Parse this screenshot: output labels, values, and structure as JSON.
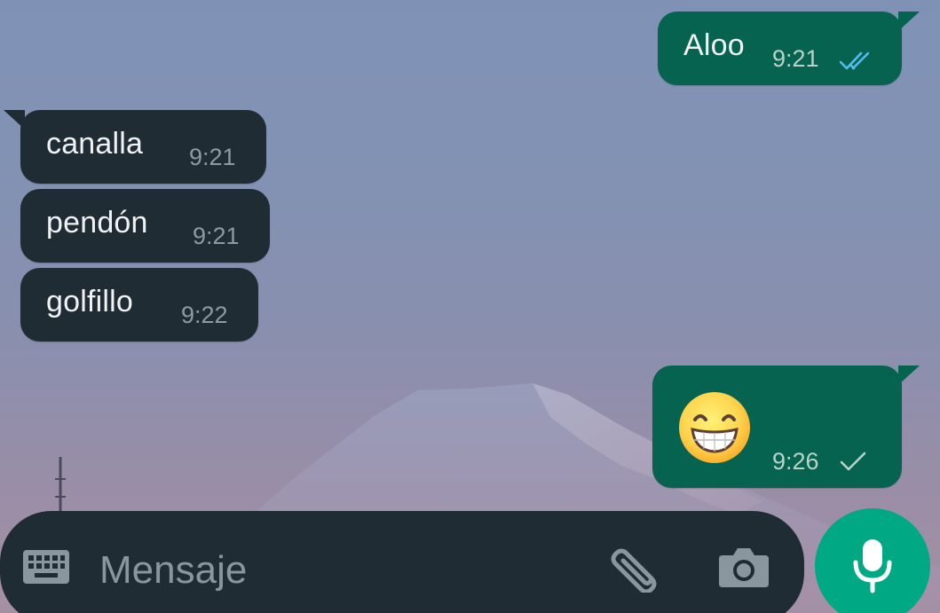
{
  "chat": {
    "messages": [
      {
        "direction": "outgoing",
        "text": "Aloo",
        "time": "9:21",
        "status": "read"
      },
      {
        "direction": "incoming",
        "text": "canalla",
        "time": "9:21"
      },
      {
        "direction": "incoming",
        "text": "pendón",
        "time": "9:21"
      },
      {
        "direction": "incoming",
        "text": "golfillo",
        "time": "9:22"
      },
      {
        "direction": "outgoing",
        "text": "",
        "emoji": "grinning-face-with-smiling-eyes",
        "time": "9:26",
        "status": "sent"
      }
    ]
  },
  "composer": {
    "placeholder": "Mensaje",
    "icons": {
      "keyboard": "keyboard-icon",
      "attach": "paperclip-icon",
      "camera": "camera-icon",
      "mic": "microphone-icon"
    }
  },
  "colors": {
    "outgoing_bubble": "#05634f",
    "incoming_bubble": "#1f2c34",
    "read_tick": "#53bdeb",
    "accent": "#00a884",
    "composer_bg": "#1f2c34"
  }
}
